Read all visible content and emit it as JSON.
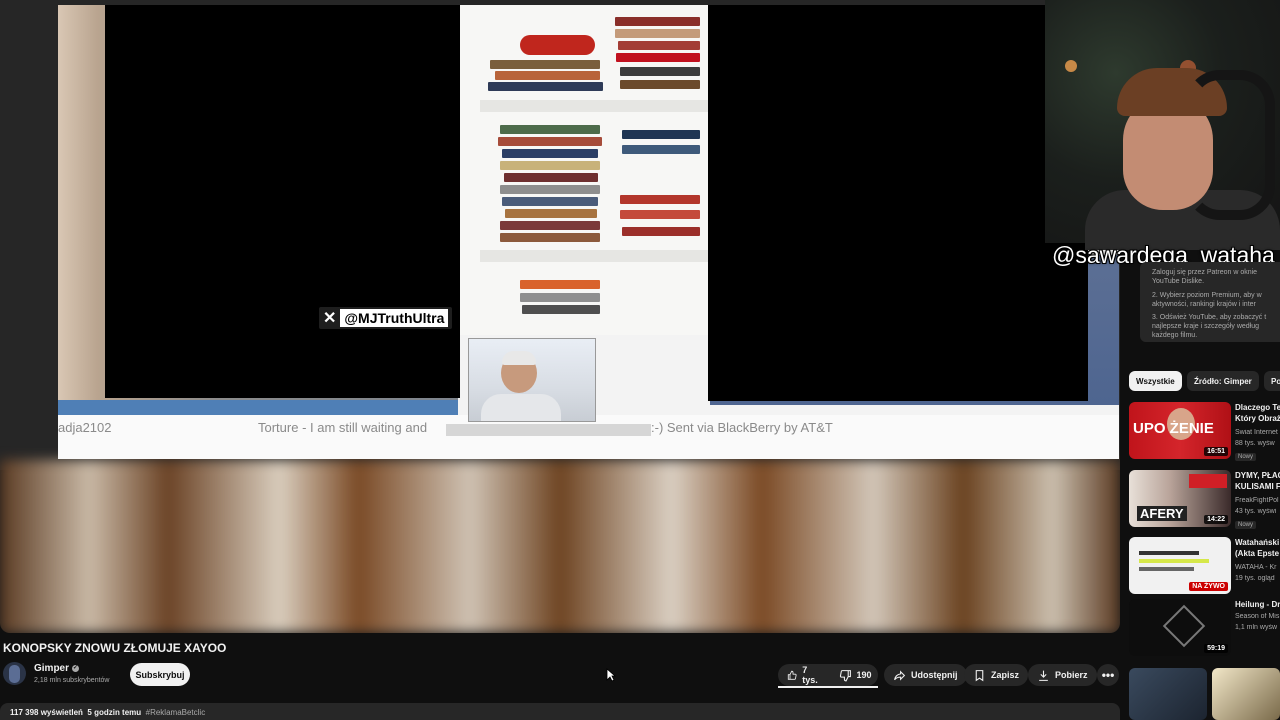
{
  "video": {
    "x_handle": "@MJTruthUltra",
    "caption_left": "adja2102",
    "caption_mid": "Torture - I am still waiting and",
    "caption_right": ":-) Sent via BlackBerry by AT&T",
    "watermark": "@sawardega_wataha"
  },
  "meta": {
    "title": "KONOPSKY ZNOWU ZŁOMUJE XAYOO",
    "channel": "Gimper",
    "subscribers": "2,18 mln subskrybentów",
    "subscribe_label": "Subskrybuj",
    "likes": "7 tys.",
    "dislikes": "190",
    "share_label": "Udostępnij",
    "save_label": "Zapisz",
    "download_label": "Pobierz",
    "more_label": "•••",
    "views": "117 398 wyświetleń",
    "time_ago": "5 godzin temu",
    "hashtag": "#ReklamaBetclic"
  },
  "rdd": {
    "items": [
      "Zaloguj się przez Patreon w oknie",
      "YouTube Dislike.",
      "2.  Wybierz poziom Premium, aby w",
      "aktywności, rankingi krajów i inter",
      "3.  Odśwież YouTube, aby zobaczyć t",
      "najlepsze kraje i szczegóły według",
      "każdego filmu."
    ]
  },
  "chips": [
    "Wszystkie",
    "Źródło: Gimper",
    "Po"
  ],
  "recommendations": [
    {
      "title1": "Dlaczego Te",
      "title2": "Który Obraż",
      "channel": "Świat Internet",
      "stats": "88 tys. wyśw",
      "badge": "Nowy",
      "duration": "16:51",
      "thumb_text": "UPO  ŻENIE"
    },
    {
      "title1": "DYMY, PŁAC",
      "title2": "KULISAMI F",
      "channel": "FreakFightPol",
      "stats": "43 tys. wyświ",
      "badge": "Nowy",
      "duration": "14:22",
      "thumb_text": "AFERY"
    },
    {
      "title1": "Watahański",
      "title2": "(Akta Epste",
      "channel": "WATAHA - Kr",
      "stats": "19 tys. ogląd",
      "badge": "",
      "duration": "NA ŻYWO",
      "thumb_text": ""
    },
    {
      "title1": "Heilung - Dr",
      "title2": "",
      "channel": "Season of Mis",
      "stats": "1,1 mln wyśw",
      "badge": "",
      "duration": "59:19",
      "thumb_text": ""
    }
  ],
  "colors": {
    "bg": "#0f0f0f",
    "pill": "#272727",
    "live": "#cc0000"
  }
}
